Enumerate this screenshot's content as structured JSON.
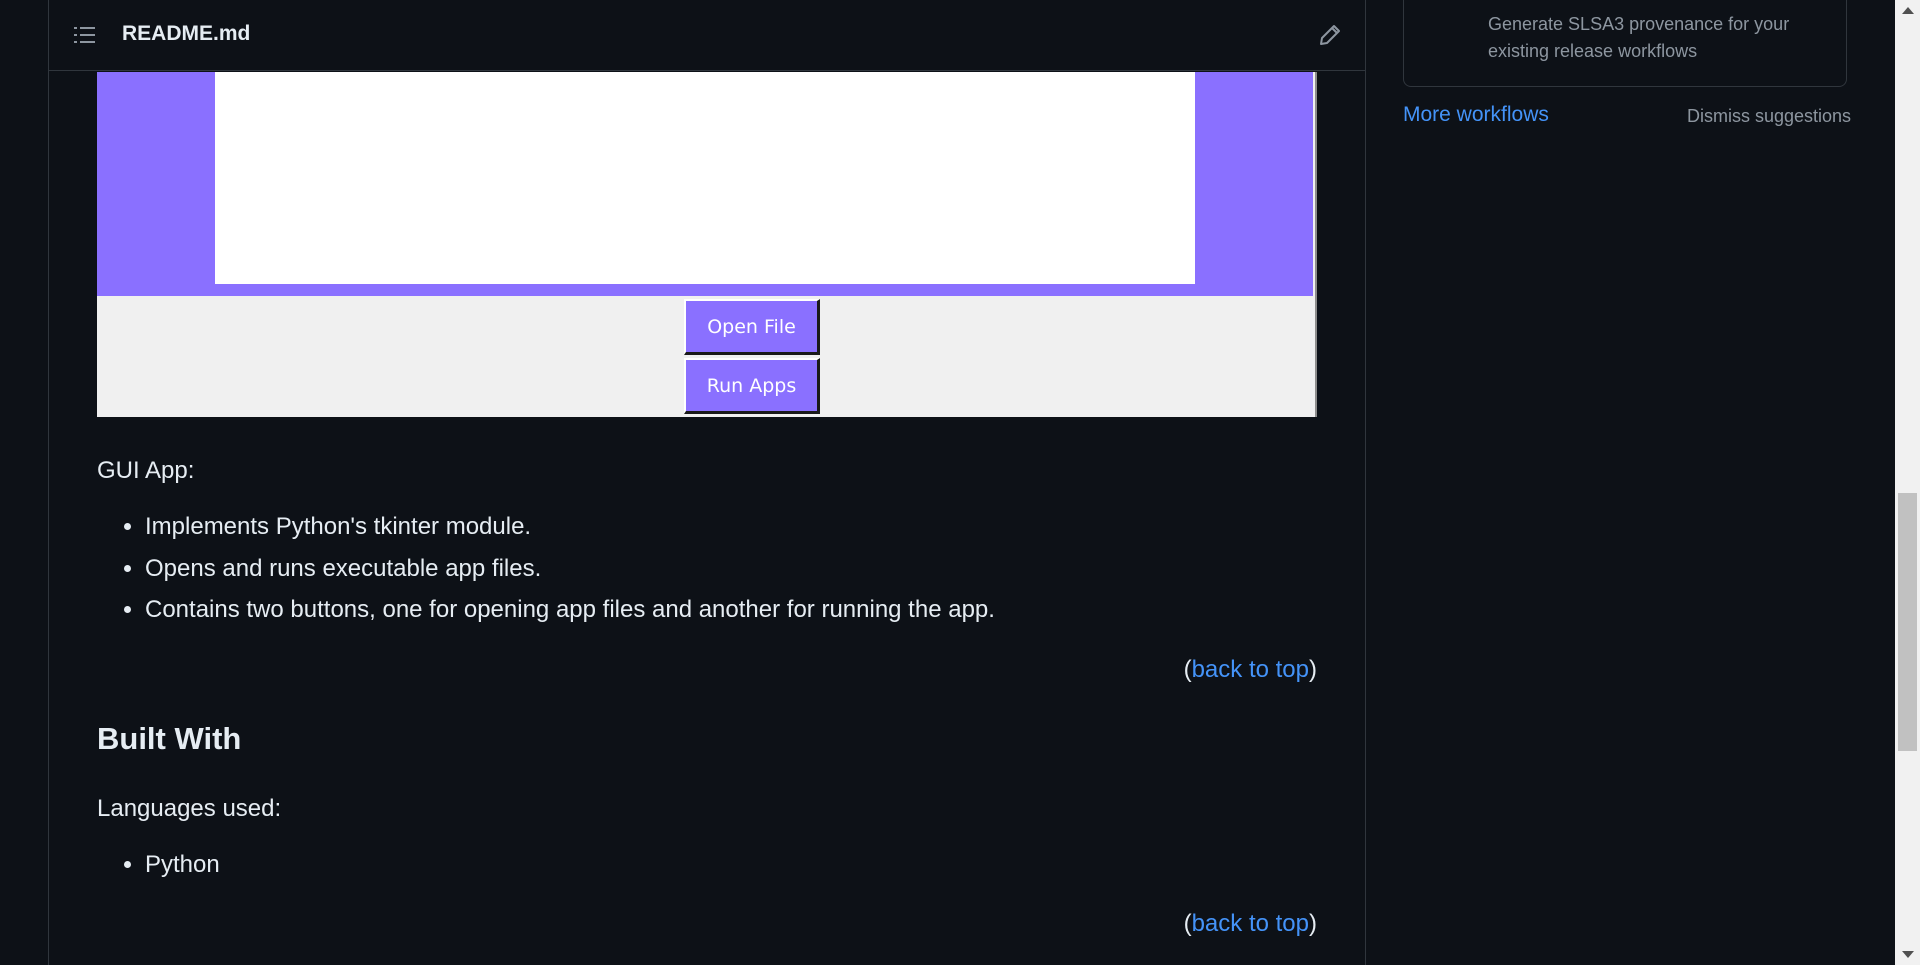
{
  "readme": {
    "title": "README.md",
    "toc_icon": "list-icon",
    "edit_icon": "pencil-icon"
  },
  "app_preview": {
    "open_file_label": "Open File",
    "run_apps_label": "Run Apps",
    "colors": {
      "accent": "#8a70ff",
      "canvas": "#ffffff",
      "window": "#f0f0f0"
    }
  },
  "content": {
    "gui_label": "GUI App:",
    "gui_points": [
      "Implements Python's tkinter module.",
      "Opens and runs executable app files.",
      "Contains two buttons, one for opening app files and another for running the app."
    ],
    "back_to_top": "back to top",
    "paren_open": "(",
    "paren_close": ")",
    "built_with_heading": "Built With",
    "languages_label": "Languages used:",
    "languages": [
      "Python"
    ]
  },
  "sidebar": {
    "card_description": "Generate SLSA3 provenance for your existing release workflows",
    "more_workflows": "More workflows",
    "dismiss": "Dismiss suggestions"
  },
  "colors": {
    "background": "#0d1117",
    "border": "#30363d",
    "link": "#4493f8",
    "muted": "#8d96a0",
    "text": "#e6edf3"
  }
}
